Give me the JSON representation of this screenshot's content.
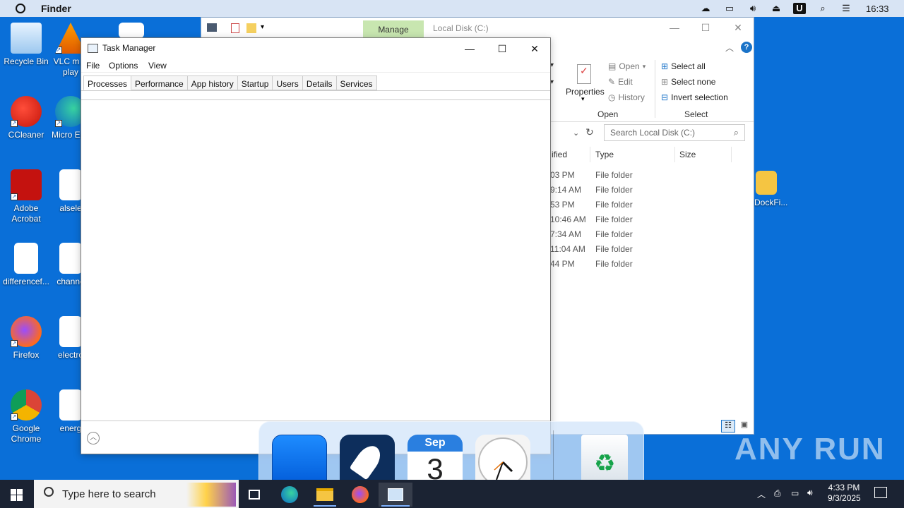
{
  "topbar": {
    "app_name": "Finder",
    "time": "16:33"
  },
  "desktop": {
    "icons": [
      {
        "label": "Recycle Bin"
      },
      {
        "label": "VLC m… play"
      },
      {
        "label": "CCleaner"
      },
      {
        "label": "Micro Edg"
      },
      {
        "label": "Adobe Acrobat"
      },
      {
        "label": "alsele"
      },
      {
        "label": "differencef..."
      },
      {
        "label": "channe"
      },
      {
        "label": "Firefox"
      },
      {
        "label": "electro"
      },
      {
        "label": "Google Chrome"
      },
      {
        "label": "energ"
      },
      {
        "label": "yDockFi..."
      }
    ]
  },
  "explorer": {
    "manage_tab": "Manage",
    "title": "Local Disk (C:)",
    "ribbon": {
      "properties": "Properties",
      "open": "Open",
      "edit": "Edit",
      "history": "History",
      "open_group": "Open",
      "select_all": "Select all",
      "select_none": "Select none",
      "invert_selection": "Invert selection",
      "select_group": "Select"
    },
    "search_placeholder": "Search Local Disk (C:)",
    "columns": {
      "modified": "ified",
      "type": "Type",
      "size": "Size"
    },
    "rows": [
      {
        "modified": "03 PM",
        "type": "File folder"
      },
      {
        "modified": "9:14 AM",
        "type": "File folder"
      },
      {
        "modified": "53 PM",
        "type": "File folder"
      },
      {
        "modified": "10:46 AM",
        "type": "File folder"
      },
      {
        "modified": "7:34 AM",
        "type": "File folder"
      },
      {
        "modified": "11:04 AM",
        "type": "File folder"
      },
      {
        "modified": "44 PM",
        "type": "File folder"
      }
    ]
  },
  "taskmanager": {
    "title": "Task Manager",
    "menu": [
      "File",
      "Options",
      "View"
    ],
    "tabs": [
      "Processes",
      "Performance",
      "App history",
      "Startup",
      "Users",
      "Details",
      "Services"
    ]
  },
  "dock": {
    "calendar_month": "Sep",
    "calendar_day": "3"
  },
  "taskbar": {
    "search_placeholder": "Type here to search",
    "time": "4:33 PM",
    "date": "9/3/2025"
  },
  "watermark": "ANY RUN"
}
